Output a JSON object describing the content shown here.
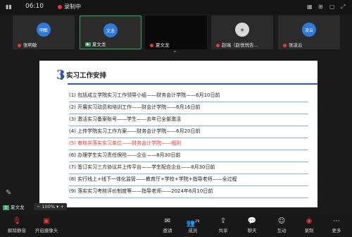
{
  "status": {
    "time": "06:10",
    "recording": "录制中"
  },
  "tiles": [
    {
      "avatar": "明敏",
      "name": "张明敏",
      "type": "avatar"
    },
    {
      "avatar": "文龙",
      "name": "夏文龙",
      "type": "avatar-active"
    },
    {
      "avatar": "",
      "name": "夏文龙",
      "type": "dark"
    },
    {
      "avatar": "",
      "name": "赵瑞（赵悦悦告...",
      "type": "photo"
    },
    {
      "avatar": "凌云",
      "name": "张凌云",
      "type": "avatar"
    }
  ],
  "slide": {
    "number": "3",
    "title": "实习工作安排",
    "items": [
      "(1)  包括成立学院实习工作领导小组——财务会计学院——6月10日前",
      "(2)  开展实习动员和培训工作——财会计学院——6月16日前",
      "(3)  激活实习备案账号——学生——去年已全部激活",
      "(4)  上传学院实习工作方案——财务会计学院——6月20日前",
      "(5)  审核并落实实习单位——财务会计学院——细则",
      "(6)  办理学生实习责任保险——企业——8月30日前",
      "(7)  签订实习三方协议并上传平台——学生配合企业——8月30日前",
      "(8)  实行线上+线下一体化监管——教育厅+学校+学院+指导老师——全过程",
      "(9)  落实实习考核评价制度等——指导老师——2024年6月10日前"
    ]
  },
  "selfview": {
    "badge": "文",
    "name": "夏文龙"
  },
  "zoom": {
    "level": "100%"
  },
  "toolbar": {
    "left": [
      {
        "label": "解除静音",
        "icon": "mic-muted-icon"
      },
      {
        "label": "开启摄像头",
        "icon": "camera-off-icon"
      }
    ],
    "center": [
      {
        "label": "邀请",
        "icon": "invite-icon"
      },
      {
        "label": "成员",
        "icon": "members-icon",
        "count": "29"
      },
      {
        "label": "共享",
        "icon": "share-icon"
      },
      {
        "label": "聊天",
        "icon": "chat-icon"
      },
      {
        "label": "互动",
        "icon": "interact-icon"
      },
      {
        "label": "录制",
        "icon": "record-icon"
      },
      {
        "label": "更多",
        "icon": "more-icon"
      }
    ]
  }
}
